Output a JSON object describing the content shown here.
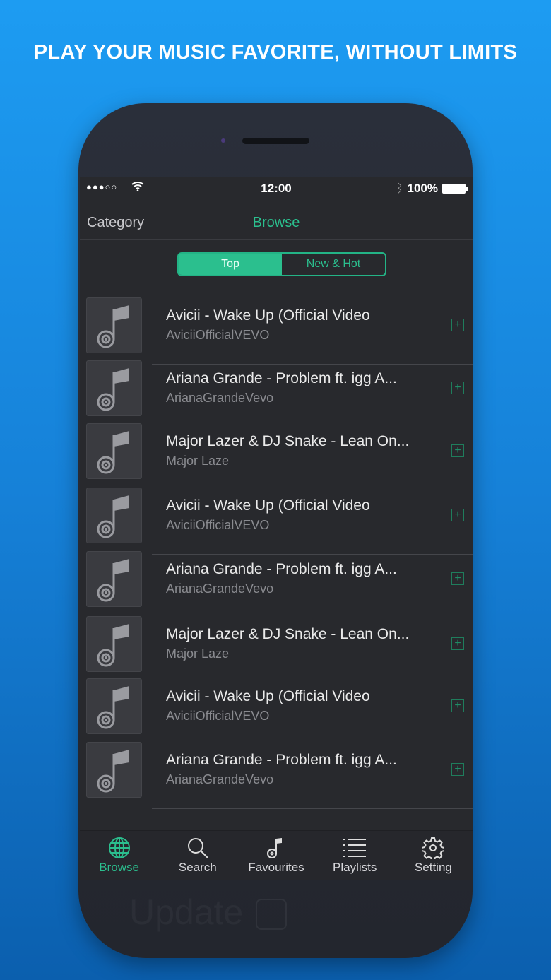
{
  "headline": "PLAY YOUR MUSIC FAVORITE, WITHOUT LIMITS",
  "status": {
    "signal": "●●●○○",
    "time": "12:00",
    "battery": "100%"
  },
  "nav": {
    "left": "Category",
    "title": "Browse"
  },
  "segments": {
    "top": "Top",
    "new_hot": "New & Hot"
  },
  "songs": [
    {
      "title": "Avicii - Wake Up (Official Video",
      "channel": "AviciiOfficialVEVO"
    },
    {
      "title": "Ariana Grande - Problem ft. igg A...",
      "channel": "ArianaGrandeVevo"
    },
    {
      "title": "Major Lazer & DJ Snake - Lean On...",
      "channel": "Major Laze"
    },
    {
      "title": "Avicii - Wake Up (Official Video",
      "channel": "AviciiOfficialVEVO"
    },
    {
      "title": "Ariana Grande - Problem ft. igg A...",
      "channel": "ArianaGrandeVevo"
    },
    {
      "title": "Major Lazer & DJ Snake - Lean On...",
      "channel": "Major Laze"
    },
    {
      "title": "Avicii - Wake Up (Official Video",
      "channel": "AviciiOfficialVEVO"
    },
    {
      "title": "Ariana Grande - Problem ft. igg A...",
      "channel": "ArianaGrandeVevo"
    }
  ],
  "add_symbol": "+",
  "tabs": {
    "browse": "Browse",
    "search": "Search",
    "favourites": "Favourites",
    "playlists": "Playlists",
    "setting": "Setting"
  },
  "ghost_text": "Update",
  "colors": {
    "accent": "#2bbf8e",
    "background": "#1d9cf2"
  }
}
